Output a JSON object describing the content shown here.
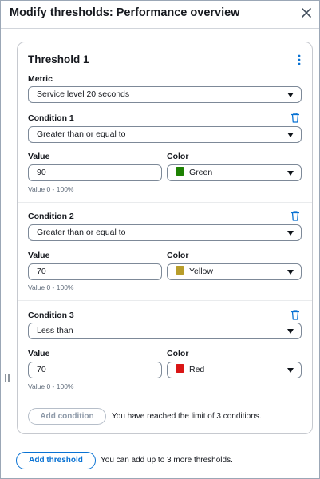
{
  "header": {
    "title": "Modify thresholds: Performance overview"
  },
  "threshold": {
    "title": "Threshold 1",
    "metric_label": "Metric",
    "metric_value": "Service level 20 seconds",
    "conditions": [
      {
        "label": "Condition 1",
        "operator": "Greater than or equal to",
        "value_label": "Value",
        "value": "90",
        "hint": "Value 0 - 100%",
        "color_label": "Color",
        "color_name": "Green",
        "color_hex": "#1d8102"
      },
      {
        "label": "Condition 2",
        "operator": "Greater than or equal to",
        "value_label": "Value",
        "value": "70",
        "hint": "Value 0 - 100%",
        "color_label": "Color",
        "color_name": "Yellow",
        "color_hex": "#b89d2b"
      },
      {
        "label": "Condition 3",
        "operator": "Less than",
        "value_label": "Value",
        "value": "70",
        "hint": "Value 0 - 100%",
        "color_label": "Color",
        "color_name": "Red",
        "color_hex": "#d91515"
      }
    ],
    "add_condition_label": "Add condition",
    "condition_limit_note": "You have reached the limit of 3 conditions."
  },
  "footer": {
    "add_threshold_label": "Add threshold",
    "threshold_note": "You can add up to 3 more thresholds."
  },
  "icons": {
    "close": "close-icon",
    "menu": "more-vertical-icon",
    "delete": "trash-icon",
    "drag": "drag-handle-icon",
    "dropdown": "caret-down-icon"
  },
  "colors": {
    "accent": "#0972d3",
    "text": "#16191f",
    "muted": "#5f6b7a"
  }
}
